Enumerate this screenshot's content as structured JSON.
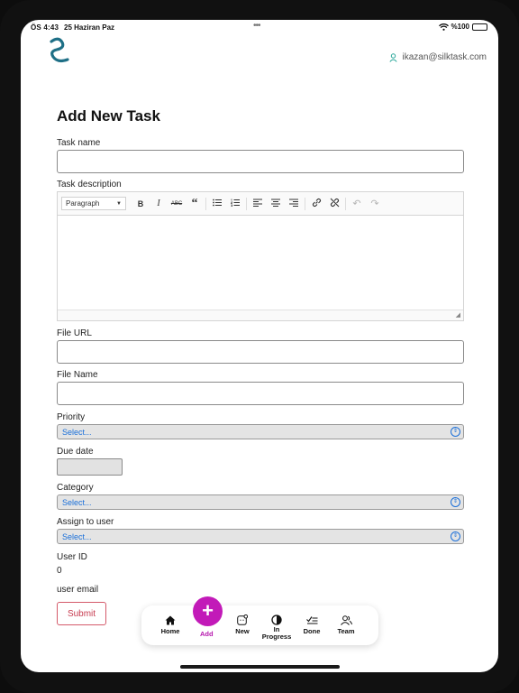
{
  "status": {
    "time": "ÖS 4:43",
    "date": "25 Haziran Paz",
    "battery": "%100"
  },
  "header": {
    "user_email": "ikazan@silktask.com"
  },
  "form": {
    "title": "Add New Task",
    "task_name_label": "Task name",
    "task_description_label": "Task description",
    "editor": {
      "paragraph_select": "Paragraph",
      "toolbar_icons": [
        "bold-icon",
        "italic-icon",
        "strikethrough-icon",
        "quote-icon",
        "bulleted-list-icon",
        "numbered-list-icon",
        "align-left-icon",
        "align-center-icon",
        "align-right-icon",
        "link-icon",
        "unlink-icon",
        "undo-icon",
        "redo-icon"
      ]
    },
    "file_url_label": "File URL",
    "file_name_label": "File Name",
    "priority_label": "Priority",
    "priority_value": "Select...",
    "due_date_label": "Due date",
    "category_label": "Category",
    "category_value": "Select...",
    "assign_label": "Assign to user",
    "assign_value": "Select...",
    "user_id_label": "User ID",
    "user_id_value": "0",
    "user_email_label": "user email",
    "submit_label": "Submit"
  },
  "tabbar": {
    "items": [
      {
        "label": "Home",
        "icon": "home-icon"
      },
      {
        "label": "Add",
        "icon": "plus-icon"
      },
      {
        "label": "New",
        "icon": "new-badge-icon"
      },
      {
        "label": "In Progress",
        "icon": "half-circle-icon"
      },
      {
        "label": "Done",
        "icon": "done-check-icon"
      },
      {
        "label": "Team",
        "icon": "team-icon"
      }
    ]
  },
  "colors": {
    "accent": "#c21ab8",
    "select_text": "#1a6fd9",
    "submit": "#c73b4f",
    "logo": "#1e6f86"
  }
}
